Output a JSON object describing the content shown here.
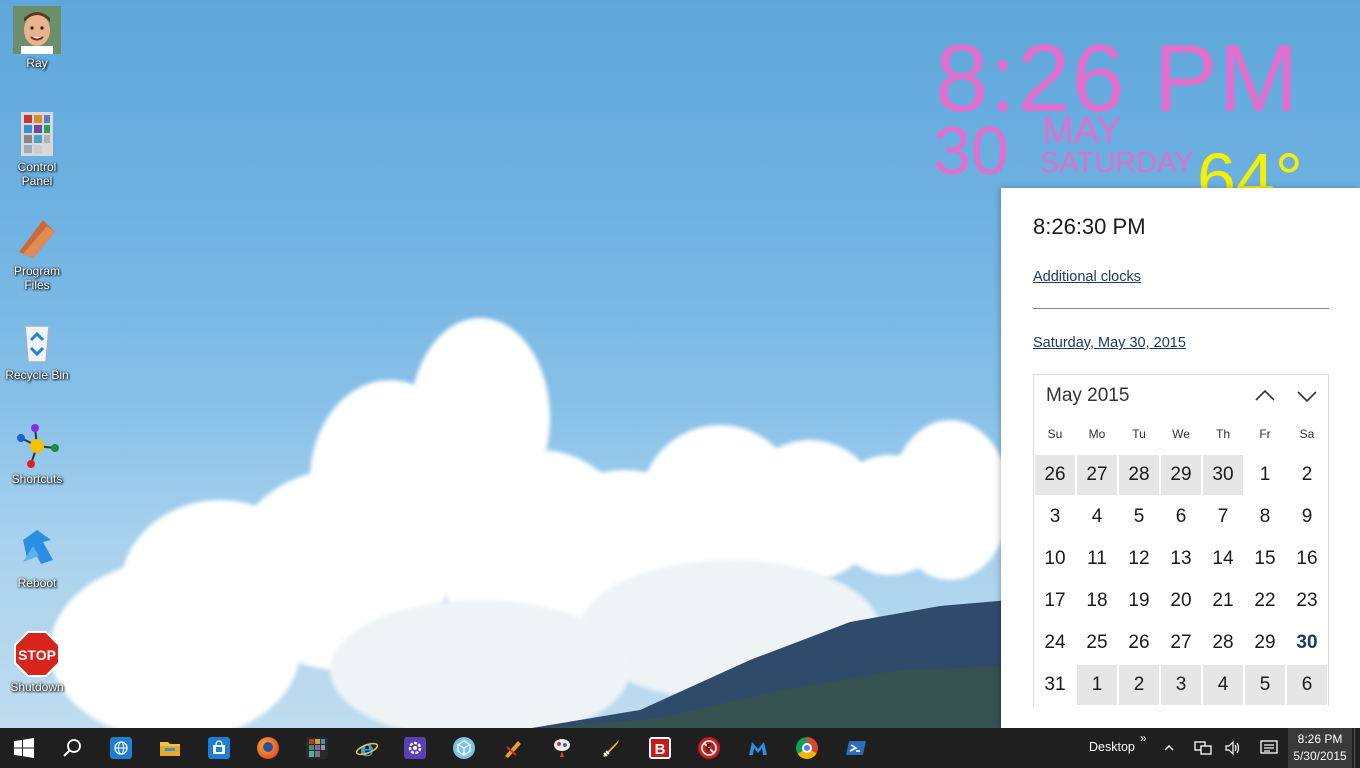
{
  "desktop": {
    "icons": [
      {
        "label": "Ray",
        "icon": "user-photo-icon"
      },
      {
        "label": "Control\nPanel",
        "icon": "control-panel-icon"
      },
      {
        "label": "Program\nFiles",
        "icon": "folder-icon"
      },
      {
        "label": "Recycle Bin",
        "icon": "recycle-bin-icon"
      },
      {
        "label": "Shortcuts",
        "icon": "shortcuts-icon"
      },
      {
        "label": "Reboot",
        "icon": "reboot-icon"
      },
      {
        "label": "Shutdown",
        "icon": "stop-sign-icon"
      }
    ]
  },
  "widget": {
    "time": "8:26 PM",
    "day": "30",
    "month": "MAY",
    "weekday": "SATURDAY",
    "temperature": "64°",
    "colors": {
      "text": "#e06fcf",
      "temperature": "#f4f000"
    }
  },
  "flyout": {
    "time": "8:26:30 PM",
    "additional_clocks": "Additional clocks",
    "date_link": "Saturday, May 30, 2015",
    "calendar": {
      "title": "May 2015",
      "weekdays": [
        "Su",
        "Mo",
        "Tu",
        "We",
        "Th",
        "Fr",
        "Sa"
      ],
      "weeks": [
        [
          "26",
          "27",
          "28",
          "29",
          "30",
          "1",
          "2"
        ],
        [
          "3",
          "4",
          "5",
          "6",
          "7",
          "8",
          "9"
        ],
        [
          "10",
          "11",
          "12",
          "13",
          "14",
          "15",
          "16"
        ],
        [
          "17",
          "18",
          "19",
          "20",
          "21",
          "22",
          "23"
        ],
        [
          "24",
          "25",
          "26",
          "27",
          "28",
          "29",
          "30"
        ],
        [
          "31",
          "1",
          "2",
          "3",
          "4",
          "5",
          "6"
        ]
      ],
      "today": "30",
      "prev_icon": "chevron-up-icon",
      "next_icon": "chevron-down-icon"
    }
  },
  "taskbar": {
    "apps": [
      "start-icon",
      "search-icon",
      "globe-icon",
      "file-explorer-icon",
      "store-icon",
      "firefox-icon",
      "app-tiles-icon",
      "internet-explorer-icon",
      "settings-icon",
      "sandbox-icon",
      "pencil-tool-icon",
      "balloon-icon",
      "sword-icon",
      "bitdefender-icon",
      "no-flash-icon",
      "malwarebytes-icon",
      "chrome-icon",
      "powershell-icon"
    ],
    "toolbar_label": "Desktop",
    "toolbar_overflow": "»",
    "clock_time": "8:26 PM",
    "clock_date": "5/30/2015",
    "colors": {
      "background": "#1f1f1f"
    }
  }
}
